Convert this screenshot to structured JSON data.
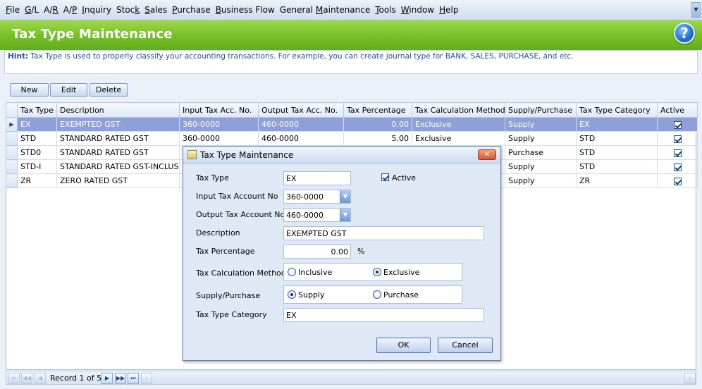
{
  "menu": [
    {
      "pre": "",
      "u": "F",
      "post": "ile"
    },
    {
      "pre": "",
      "u": "G",
      "post": "/L"
    },
    {
      "pre": "A/",
      "u": "R",
      "post": ""
    },
    {
      "pre": "A/",
      "u": "P",
      "post": ""
    },
    {
      "pre": "",
      "u": "I",
      "post": "nquiry"
    },
    {
      "pre": "Stoc",
      "u": "k",
      "post": ""
    },
    {
      "pre": "",
      "u": "S",
      "post": "ales"
    },
    {
      "pre": "",
      "u": "P",
      "post": "urchase"
    },
    {
      "pre": "",
      "u": "B",
      "post": "usiness Flow"
    },
    {
      "pre": "General ",
      "u": "M",
      "post": "aintenance"
    },
    {
      "pre": "",
      "u": "T",
      "post": "ools"
    },
    {
      "pre": "",
      "u": "W",
      "post": "indow"
    },
    {
      "pre": "",
      "u": "H",
      "post": "elp"
    }
  ],
  "header": {
    "title": "Tax Type Maintenance",
    "help_icon": "?"
  },
  "hint": {
    "label": "Hint:",
    "text": " Tax Type is used to properly classify your accounting transactions. For example, you can create journal type for BANK, SALES, PURCHASE, and etc."
  },
  "toolbar": {
    "new": "New",
    "edit": "Edit",
    "delete": "Delete"
  },
  "grid": {
    "columns": [
      "Tax Type",
      "Description",
      "Input Tax Acc. No.",
      "Output Tax Acc. No.",
      "Tax Percentage",
      "Tax Calculation Method",
      "Supply/Purchase",
      "Tax Type Category",
      "Active"
    ],
    "rows": [
      {
        "tax_type": "EX",
        "description": "EXEMPTED GST",
        "input": "360-0000",
        "output": "460-0000",
        "pct": "0.00",
        "method": "Exclusive",
        "supply": "Supply",
        "category": "EX"
      },
      {
        "tax_type": "STD",
        "description": "STANDARD RATED GST",
        "input": "360-0000",
        "output": "460-0000",
        "pct": "5.00",
        "method": "Exclusive",
        "supply": "Supply",
        "category": "STD"
      },
      {
        "tax_type": "STD0",
        "description": "STANDARD RATED GST",
        "input": "",
        "output": "",
        "pct": "",
        "method": "",
        "supply": "Purchase",
        "category": "STD"
      },
      {
        "tax_type": "STD-I",
        "description": "STANDARD RATED GST-INCLUSIVE",
        "input": "",
        "output": "",
        "pct": "",
        "method": "",
        "supply": "Supply",
        "category": "STD"
      },
      {
        "tax_type": "ZR",
        "description": "ZERO RATED GST",
        "input": "",
        "output": "",
        "pct": "",
        "method": "",
        "supply": "Supply",
        "category": "ZR"
      }
    ]
  },
  "navigator": {
    "text": "Record 1 of 5"
  },
  "dialog": {
    "title": "Tax Type Maintenance",
    "labels": {
      "tax_type": "Tax Type",
      "input_acc": "Input Tax Account No",
      "output_acc": "Output Tax Account No",
      "description": "Description",
      "tax_pct": "Tax Percentage",
      "calc_method": "Tax Calculation Method",
      "supply_purchase": "Supply/Purchase",
      "category": "Tax Type Category",
      "active": "Active",
      "pct_sign": "%"
    },
    "values": {
      "tax_type": "EX",
      "input_acc": "360-0000",
      "output_acc": "460-0000",
      "description": "EXEMPTED GST",
      "tax_pct": "0.00",
      "category": "EX"
    },
    "options": {
      "inclusive": "Inclusive",
      "exclusive": "Exclusive",
      "supply": "Supply",
      "purchase": "Purchase"
    },
    "buttons": {
      "ok": "OK",
      "cancel": "Cancel"
    }
  }
}
